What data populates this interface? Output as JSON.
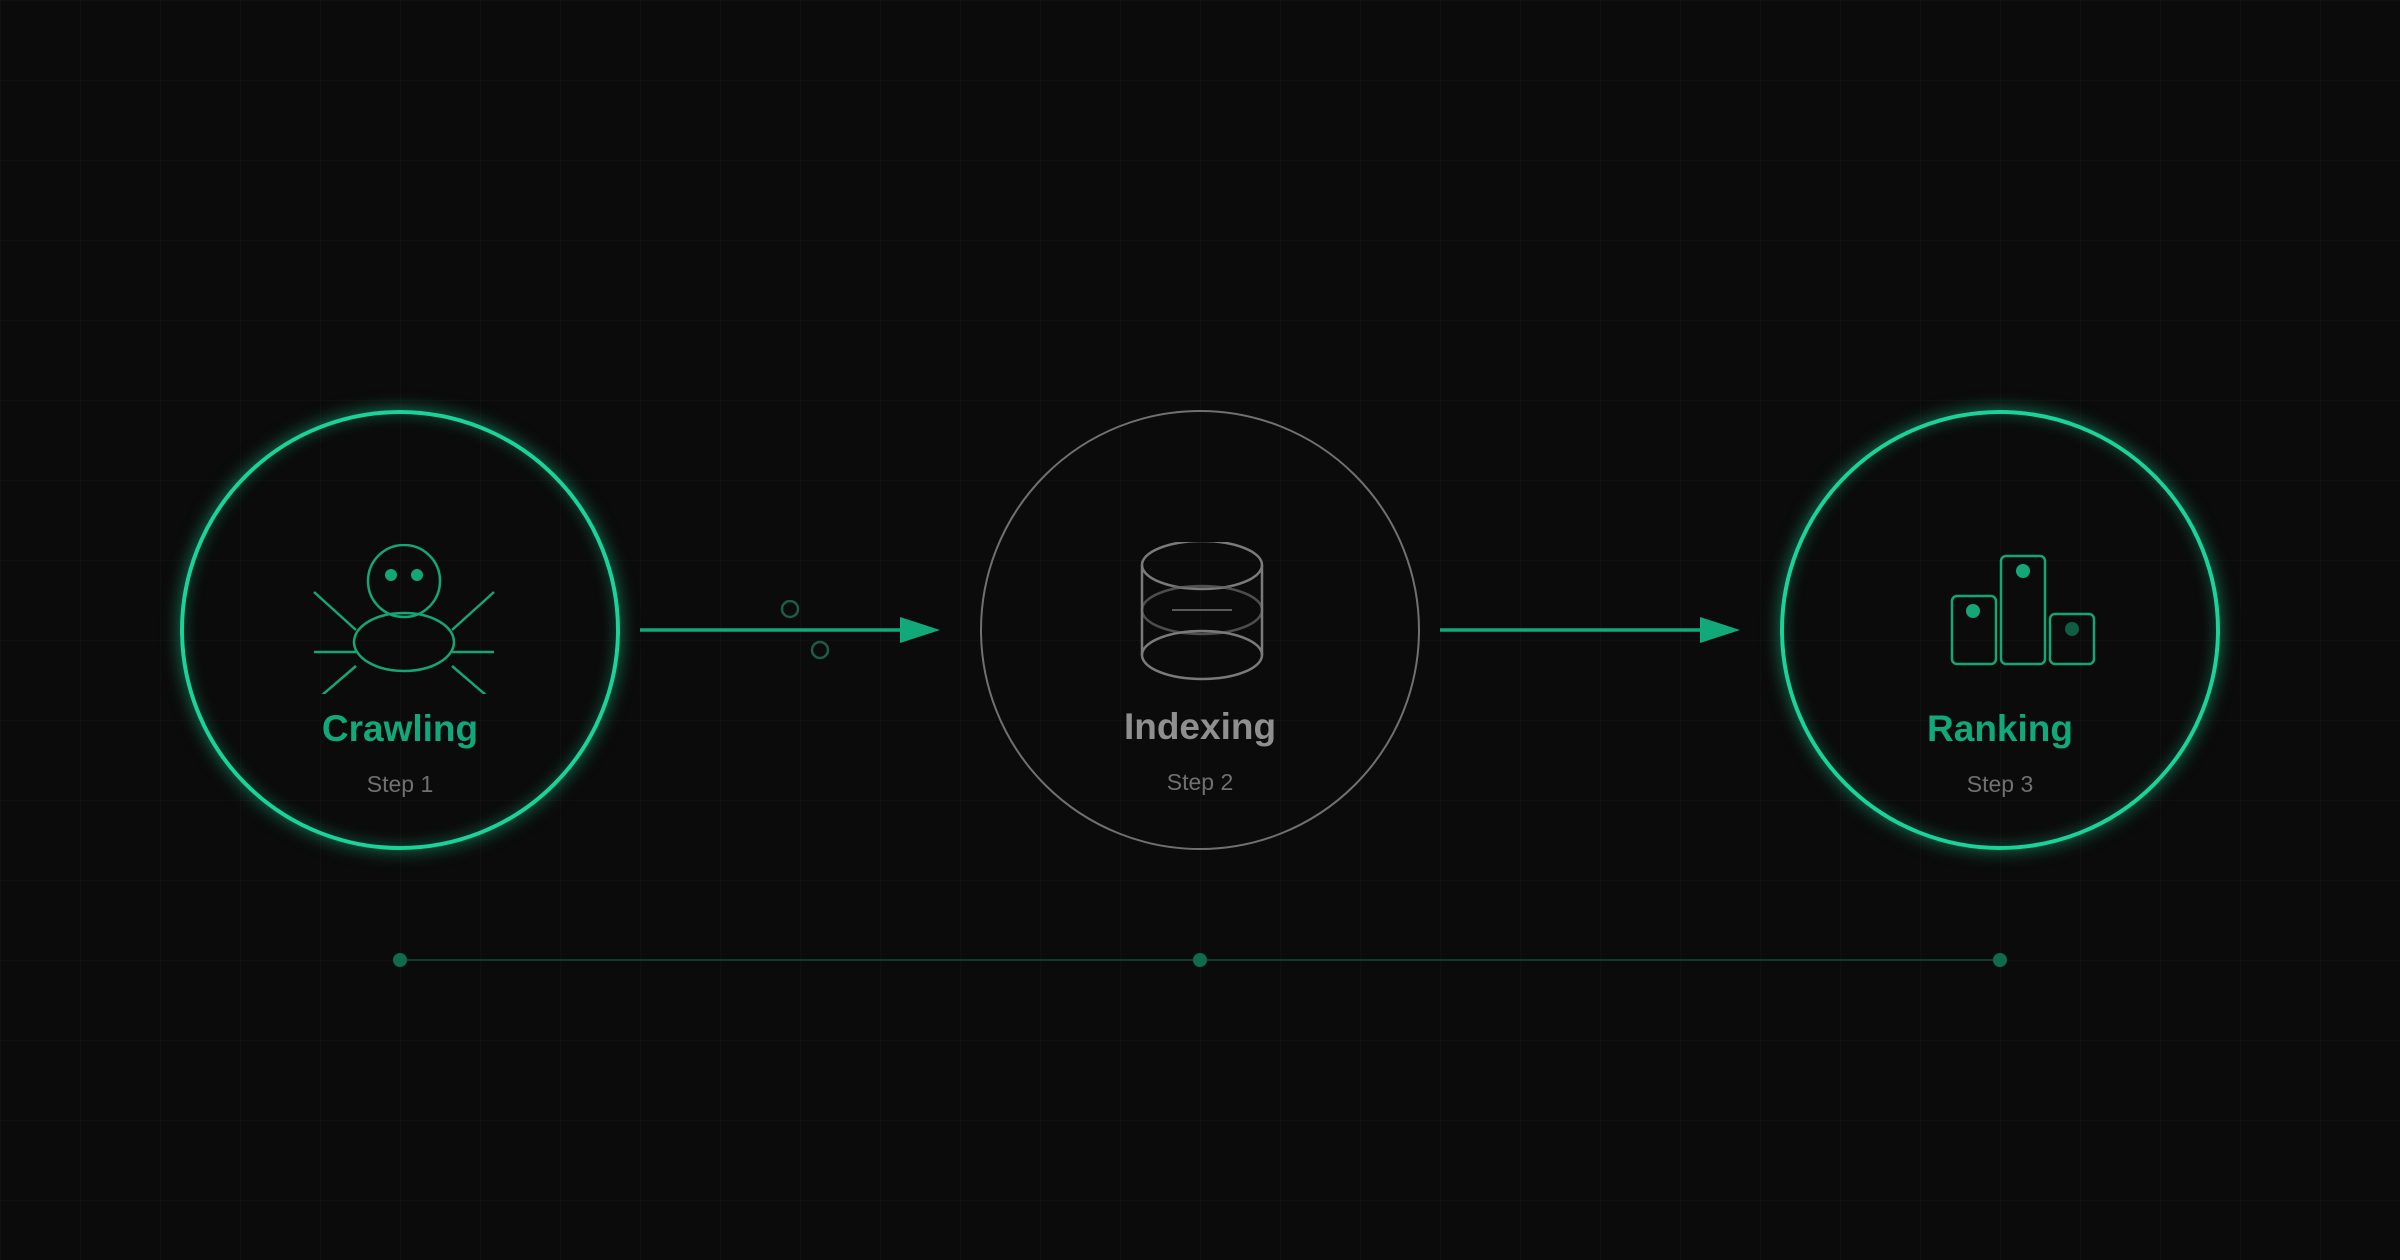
{
  "colors": {
    "accent": "#19d398",
    "accent_dim": "#0f7a58",
    "inactive": "#707070",
    "background": "#0b0b0b"
  },
  "steps": [
    {
      "title": "Crawling",
      "subtitle": "Step 1",
      "state": "active",
      "icon": "spider-icon"
    },
    {
      "title": "Indexing",
      "subtitle": "Step 2",
      "state": "inactive",
      "icon": "database-icon"
    },
    {
      "title": "Ranking",
      "subtitle": "Step 3",
      "state": "active",
      "icon": "podium-icon"
    }
  ],
  "arrows": [
    "arrow-right-icon",
    "arrow-right-icon"
  ],
  "timeline": {
    "markers": 3
  }
}
